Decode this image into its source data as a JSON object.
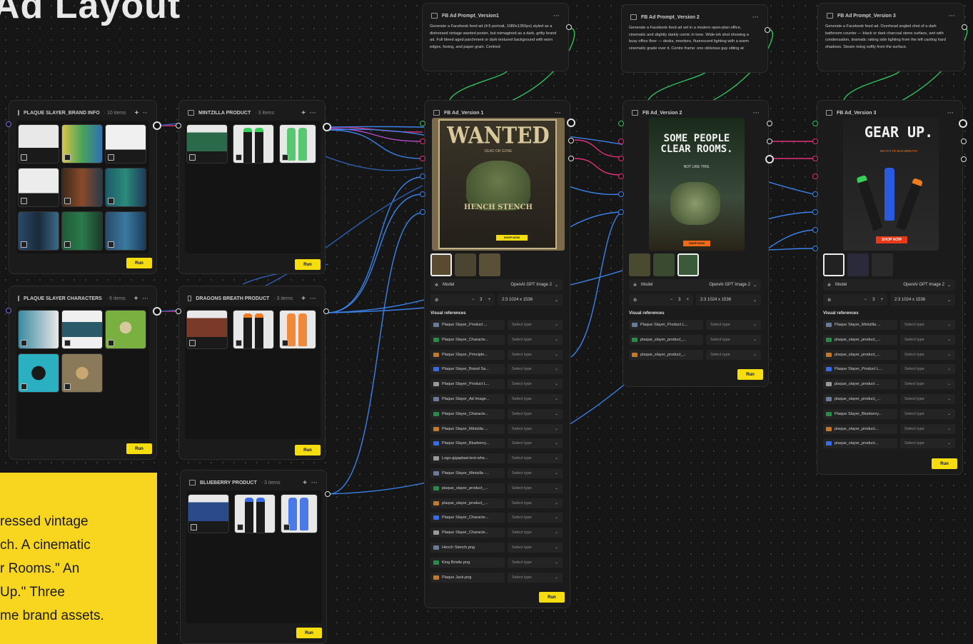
{
  "canvas_title": "Ad Layout",
  "yellow_note_lines": [
    "ressed vintage",
    "ch. A cinematic",
    "r Rooms.\" An",
    "Up.\" Three",
    "me brand assets."
  ],
  "run_label": "Run",
  "groups": {
    "brand_info": {
      "title": "PLAQUE SLAYER_BRAND INFO",
      "count": "· 10 items"
    },
    "characters": {
      "title": "PLAQUE SLAYER CHARACTERS",
      "count": "· 6 items"
    },
    "mintzilla": {
      "title": "MINTZILLA PRODUCT",
      "count": "· 3 items"
    },
    "dragons": {
      "title": "DRAGONS BREATH PRODUCT",
      "count": "· 3 items"
    },
    "blueberry": {
      "title": "BLUEBERRY PRODUCT",
      "count": "· 3 items"
    }
  },
  "prompts": [
    {
      "title": "FB Ad Prompt_Version1",
      "text": "Generate a Facebook feed ad (4:5 portrait, 1080x1350px) styled as a distressed vintage wanted poster, but reimagined as a dark, gritty brand ad. Full bleed aged parchment or dark textured background with worn edges, foxing, and paper grain. Centred"
    },
    {
      "title": "FB Ad Prompt_Version 2",
      "text": "Generate a Facebook feed ad set in a modern open-plan office, cinematic and slightly darkly comic in tone. Wide-ish shot showing a busy office floor — desks, monitors, fluorescent lighting with a warm cinematic grade over it. Centre frame: one oblivious guy sitting at"
    },
    {
      "title": "FB Ad Prompt_Version 3",
      "text": "Generate a Facebook feed ad. Overhead angled shot of a dark bathroom counter — black or dark charcoal stone surface, wet with condensation, dramatic raking side lighting from the left casting hard shadows. Steam rising softly from the surface."
    }
  ],
  "ads": [
    {
      "title": "FB Ad_Version 1",
      "poster_head": "WANTED",
      "poster_sub": "DEAD OR GONE",
      "poster_mid": "HENCH STENCH",
      "poster_btn": "SHOP NOW",
      "model_label": "Model",
      "model_value": "OpenAI GPT Image 2",
      "count": "3",
      "ratio": "2:3  1024 x 1536",
      "refs_label": "Visual references",
      "refs": [
        "Plaque Slayer_Product ...",
        "Plaque Slayer_Characte...",
        "Plaque Slayer_Principle...",
        "Plaque Slayer_Brand Sa...",
        "Plaque Slayer_Product L...",
        "Plaque Slayer_Ad Image...",
        "Plaque Slayer_Characte...",
        "Plaque Slayer_Mintzilla ...",
        "Plaque Slayer_Blueberry...",
        "Logo-gigaplaat-text-whe...",
        "Plaque Slayer_Mintzilla -...",
        "plaque_slayer_product_...",
        "plaque_slayer_product_...",
        "Plaque Slayer_Characte...",
        "Plaque Slayer_Characte...",
        "Hench Stench.png",
        "King Bristle.png",
        "Plaque Jack.png"
      ],
      "select_placeholder": "Select type"
    },
    {
      "title": "FB Ad_Version 2",
      "poster_head": "SOME PEOPLE CLEAR ROOMS.",
      "poster_sub": "NOT LIKE THIS.",
      "poster_btn": "SHOP NOW",
      "model_label": "Model",
      "model_value": "OpenAI GPT Image 2",
      "count": "3",
      "ratio": "2:3  1024 x 1536",
      "refs_label": "Visual references",
      "refs": [
        "Plaque Slayer_Product L...",
        "plaque_slayer_product_...",
        "plaque_slayer_product_..."
      ],
      "select_placeholder": "Select type"
    },
    {
      "title": "FB Ad_Version 3",
      "poster_head": "GEAR UP.",
      "poster_sub": "DEATH TO BAD BREATH",
      "poster_btn": "SHOP NOW",
      "model_label": "Model",
      "model_value": "OpenAI GPT Image 2",
      "count": "3",
      "ratio": "2:3  1024 x 1536",
      "refs_label": "Visual references",
      "refs": [
        "Plaque Slayer_Mintzilla ...",
        "plaque_slayer_product_...",
        "plaque_slayer_product_...",
        "Plaque Slayer_Product L...",
        "plaque_slayer_product ...",
        "plaque_slayer_product_...",
        "Plaque Slayer_Blueberry...",
        "plaque_slayer_product...",
        "plaque_slayer_product..."
      ],
      "select_placeholder": "Select type"
    }
  ],
  "colors": {
    "accent_yellow": "#f5dd10",
    "wire_pink": "#e2307a",
    "wire_blue": "#3a82e8",
    "wire_green": "#2fbf5f"
  }
}
